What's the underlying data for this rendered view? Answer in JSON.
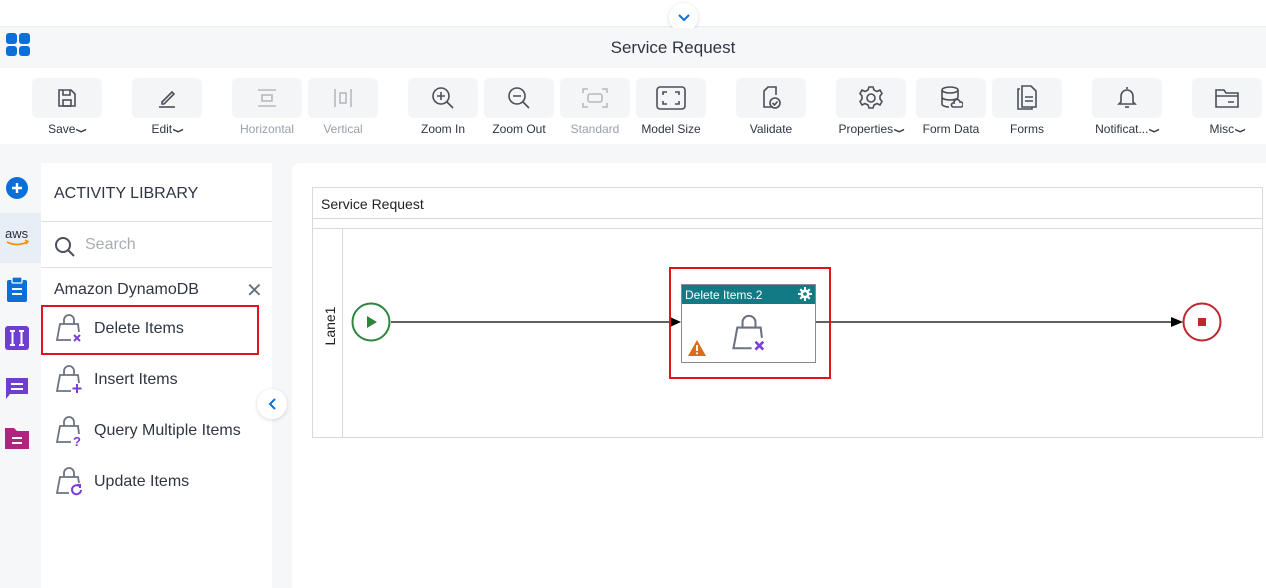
{
  "header": {
    "title": "Service Request",
    "collapse_icon": "chevron-down-icon",
    "apps_icon": "apps-grid-icon"
  },
  "toolbar": {
    "items": [
      {
        "label": "Save",
        "icon": "save-icon",
        "dropdown": true,
        "enabled": true
      },
      {
        "label": "Edit",
        "icon": "edit-icon",
        "dropdown": true,
        "enabled": true
      },
      {
        "label": "Horizontal",
        "icon": "horizontal-icon",
        "dropdown": false,
        "enabled": false
      },
      {
        "label": "Vertical",
        "icon": "vertical-icon",
        "dropdown": false,
        "enabled": false
      },
      {
        "label": "Zoom In",
        "icon": "zoom-in-icon",
        "dropdown": false,
        "enabled": true
      },
      {
        "label": "Zoom Out",
        "icon": "zoom-out-icon",
        "dropdown": false,
        "enabled": true
      },
      {
        "label": "Standard",
        "icon": "standard-icon",
        "dropdown": false,
        "enabled": false
      },
      {
        "label": "Model Size",
        "icon": "model-size-icon",
        "dropdown": false,
        "enabled": true
      },
      {
        "label": "Validate",
        "icon": "validate-icon",
        "dropdown": false,
        "enabled": true
      },
      {
        "label": "Properties",
        "icon": "gear-icon",
        "dropdown": true,
        "enabled": true
      },
      {
        "label": "Form Data",
        "icon": "database-icon",
        "dropdown": false,
        "enabled": true
      },
      {
        "label": "Forms",
        "icon": "forms-icon",
        "dropdown": false,
        "enabled": true
      },
      {
        "label": "Notificat...",
        "icon": "bell-icon",
        "dropdown": true,
        "enabled": true
      },
      {
        "label": "Misc",
        "icon": "folder-icon",
        "dropdown": true,
        "enabled": true
      }
    ]
  },
  "rail": {
    "items": [
      {
        "icon": "add-icon",
        "color": "#0b6fd8"
      },
      {
        "icon": "aws-icon",
        "label": "aws",
        "selected": true
      },
      {
        "icon": "clipboard-icon",
        "color": "#0b6fd8"
      },
      {
        "icon": "variable-icon",
        "color": "#6e3fcf",
        "label": "I"
      },
      {
        "icon": "chat-icon",
        "color": "#6e3fcf"
      },
      {
        "icon": "folder-doc-icon",
        "color": "#b0247f"
      }
    ]
  },
  "library": {
    "title": "ACTIVITY LIBRARY",
    "search_placeholder": "Search",
    "category": "Amazon DynamoDB",
    "items": [
      {
        "label": "Delete Items",
        "badge": "x",
        "selected": true
      },
      {
        "label": "Insert Items",
        "badge": "+"
      },
      {
        "label": "Query Multiple Items",
        "badge": "?"
      },
      {
        "label": "Update Items",
        "badge": "refresh"
      }
    ]
  },
  "canvas": {
    "pool_title": "Service Request",
    "lane_label": "Lane1",
    "task": {
      "title": "Delete Items.2",
      "warning": true
    },
    "colors": {
      "task_header": "#117a85",
      "start": "#2e8540",
      "end": "#c0262d",
      "selection": "#e0131b",
      "warning": "#e06b16"
    }
  }
}
